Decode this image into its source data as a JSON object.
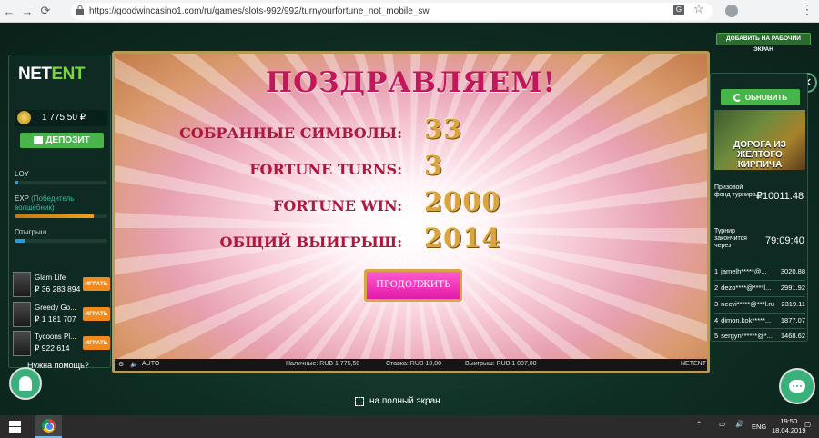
{
  "browser": {
    "url": "https://goodwincasino1.com/ru/games/slots-992/992/turnyourfortune_not_mobile_sw"
  },
  "header": {
    "add_desktop": "ДОБАВИТЬ НА РАБОЧИЙ ЭКРАН"
  },
  "left": {
    "logo_a": "NET",
    "logo_b": "ENT",
    "balance": "1 775,50 ₽",
    "deposit": "ДЕПОЗИТ",
    "loy": "LOY",
    "exp": "EXP",
    "exp_sub": "(Победитель волшебник)",
    "exp_progress": 0.85,
    "loy_progress": 0.04,
    "wager": "Отыгрыш",
    "wager_progress": 0.12,
    "games": [
      {
        "name": "Glam Life",
        "amount": "₽ 36 283 894",
        "play": "ИГРАТЬ"
      },
      {
        "name": "Greedy Go...",
        "amount": "₽ 1 181 707",
        "play": "ИГРАТЬ"
      },
      {
        "name": "Tycoons Pl...",
        "amount": "₽ 922 614",
        "play": "ИГРАТЬ"
      }
    ],
    "help": "Нужна помощь?"
  },
  "game": {
    "title": "ПОЗДРАВЛЯЕМ!",
    "rows": [
      {
        "label": "СОБРАННЫЕ СИМВОЛЫ:",
        "value": "33"
      },
      {
        "label": "FORTUNE TURNS:",
        "value": "3"
      },
      {
        "label": "FORTUNE WIN:",
        "value": "2000"
      },
      {
        "label": "ОБЩИЙ ВЫИГРЫШ:",
        "value": "2014"
      }
    ],
    "continue": "ПРОДОЛЖИТЬ",
    "status": {
      "auto": "AUTO",
      "cash": "Наличные: RUB 1 775,50",
      "bet": "Ставка: RUB 10,00",
      "win": "Выигрыш: RUB 1 007,00",
      "brand": "NETENT"
    }
  },
  "right": {
    "refresh": "ОБНОВИТЬ",
    "promo": "ДОРОГА ИЗ ЖЕЛТОГО КИРПИЧА",
    "prize_label": "Призовой фонд турнира",
    "prize_value": "₽10011.48",
    "ends_label": "Турнир закончится через",
    "ends_value": "79:09:40",
    "leaders": [
      {
        "rank": "1",
        "name": "jamelh*****@...",
        "amount": "3020.88"
      },
      {
        "rank": "2",
        "name": "dezo****@****l...",
        "amount": "2991.92"
      },
      {
        "rank": "3",
        "name": "necvi*****@***l.ru",
        "amount": "2319.11"
      },
      {
        "rank": "4",
        "name": "dimon.kok*****...",
        "amount": "1877.07"
      },
      {
        "rank": "5",
        "name": "sergyn******@*...",
        "amount": "1468.62"
      }
    ]
  },
  "footer": {
    "fullscreen": "на полный экран"
  },
  "taskbar": {
    "lang": "ENG",
    "time": "19:50",
    "date": "18.04.2019"
  }
}
